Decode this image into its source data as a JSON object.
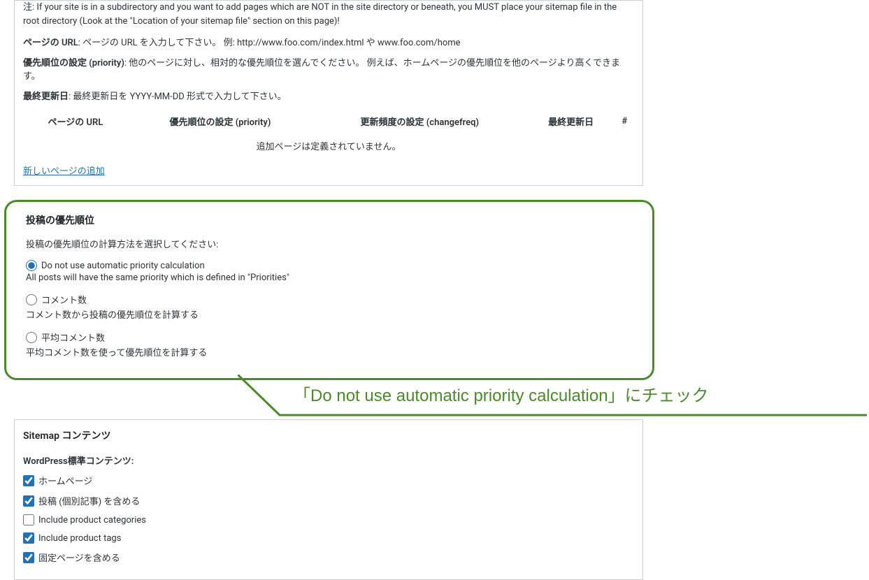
{
  "top_box": {
    "note_text": "注: If your site is in a subdirectory and you want to add pages which are NOT in the site directory or beneath, you MUST place your sitemap file in the root directory (Look at the \"Location of your sitemap file\" section on this page)!",
    "url_label": "ページの URL",
    "url_desc": ": ページの URL を入力して下さい。 例: http://www.foo.com/index.html や www.foo.com/home",
    "priority_label": "優先順位の設定 (priority)",
    "priority_desc": ": 他のページに対し、相対的な優先順位を選んでください。 例えば、ホームページの優先順位を他のページより高くできます。",
    "lastmod_label": "最終更新日",
    "lastmod_desc": ": 最終更新日を YYYY-MM-DD 形式で入力して下さい。",
    "table_headers": {
      "url": "ページの URL",
      "priority": "優先順位の設定 (priority)",
      "changefreq": "更新頻度の設定 (changefreq)",
      "lastmod": "最終更新日",
      "hash": "#"
    },
    "empty_message": "追加ページは定義されていません。",
    "add_link": "新しいページの追加"
  },
  "priority_box": {
    "title": "投稿の優先順位",
    "intro": "投稿の優先順位の計算方法を選択してください:",
    "options": [
      {
        "label": "Do not use automatic priority calculation",
        "desc": "All posts will have the same priority which is defined in \"Priorities\"",
        "checked": true
      },
      {
        "label": "コメント数",
        "desc": "コメント数から投稿の優先順位を計算する",
        "checked": false
      },
      {
        "label": "平均コメント数",
        "desc": "平均コメント数を使って優先順位を計算する",
        "checked": false
      }
    ]
  },
  "callout": {
    "text": "「Do not use automatic priority calculation」にチェック"
  },
  "sitemap_box": {
    "title": "Sitemap コンテンツ",
    "subsection": "WordPress標準コンテンツ:",
    "items": [
      {
        "label": "ホームページ",
        "checked": true
      },
      {
        "label": "投稿 (個別記事) を含める",
        "checked": true
      },
      {
        "label": "Include product categories",
        "checked": false
      },
      {
        "label": "Include product tags",
        "checked": true
      },
      {
        "label": "固定ページを含める",
        "checked": true
      }
    ]
  },
  "colors": {
    "highlight_green": "#4a8a2a",
    "link_blue": "#2271b1"
  }
}
